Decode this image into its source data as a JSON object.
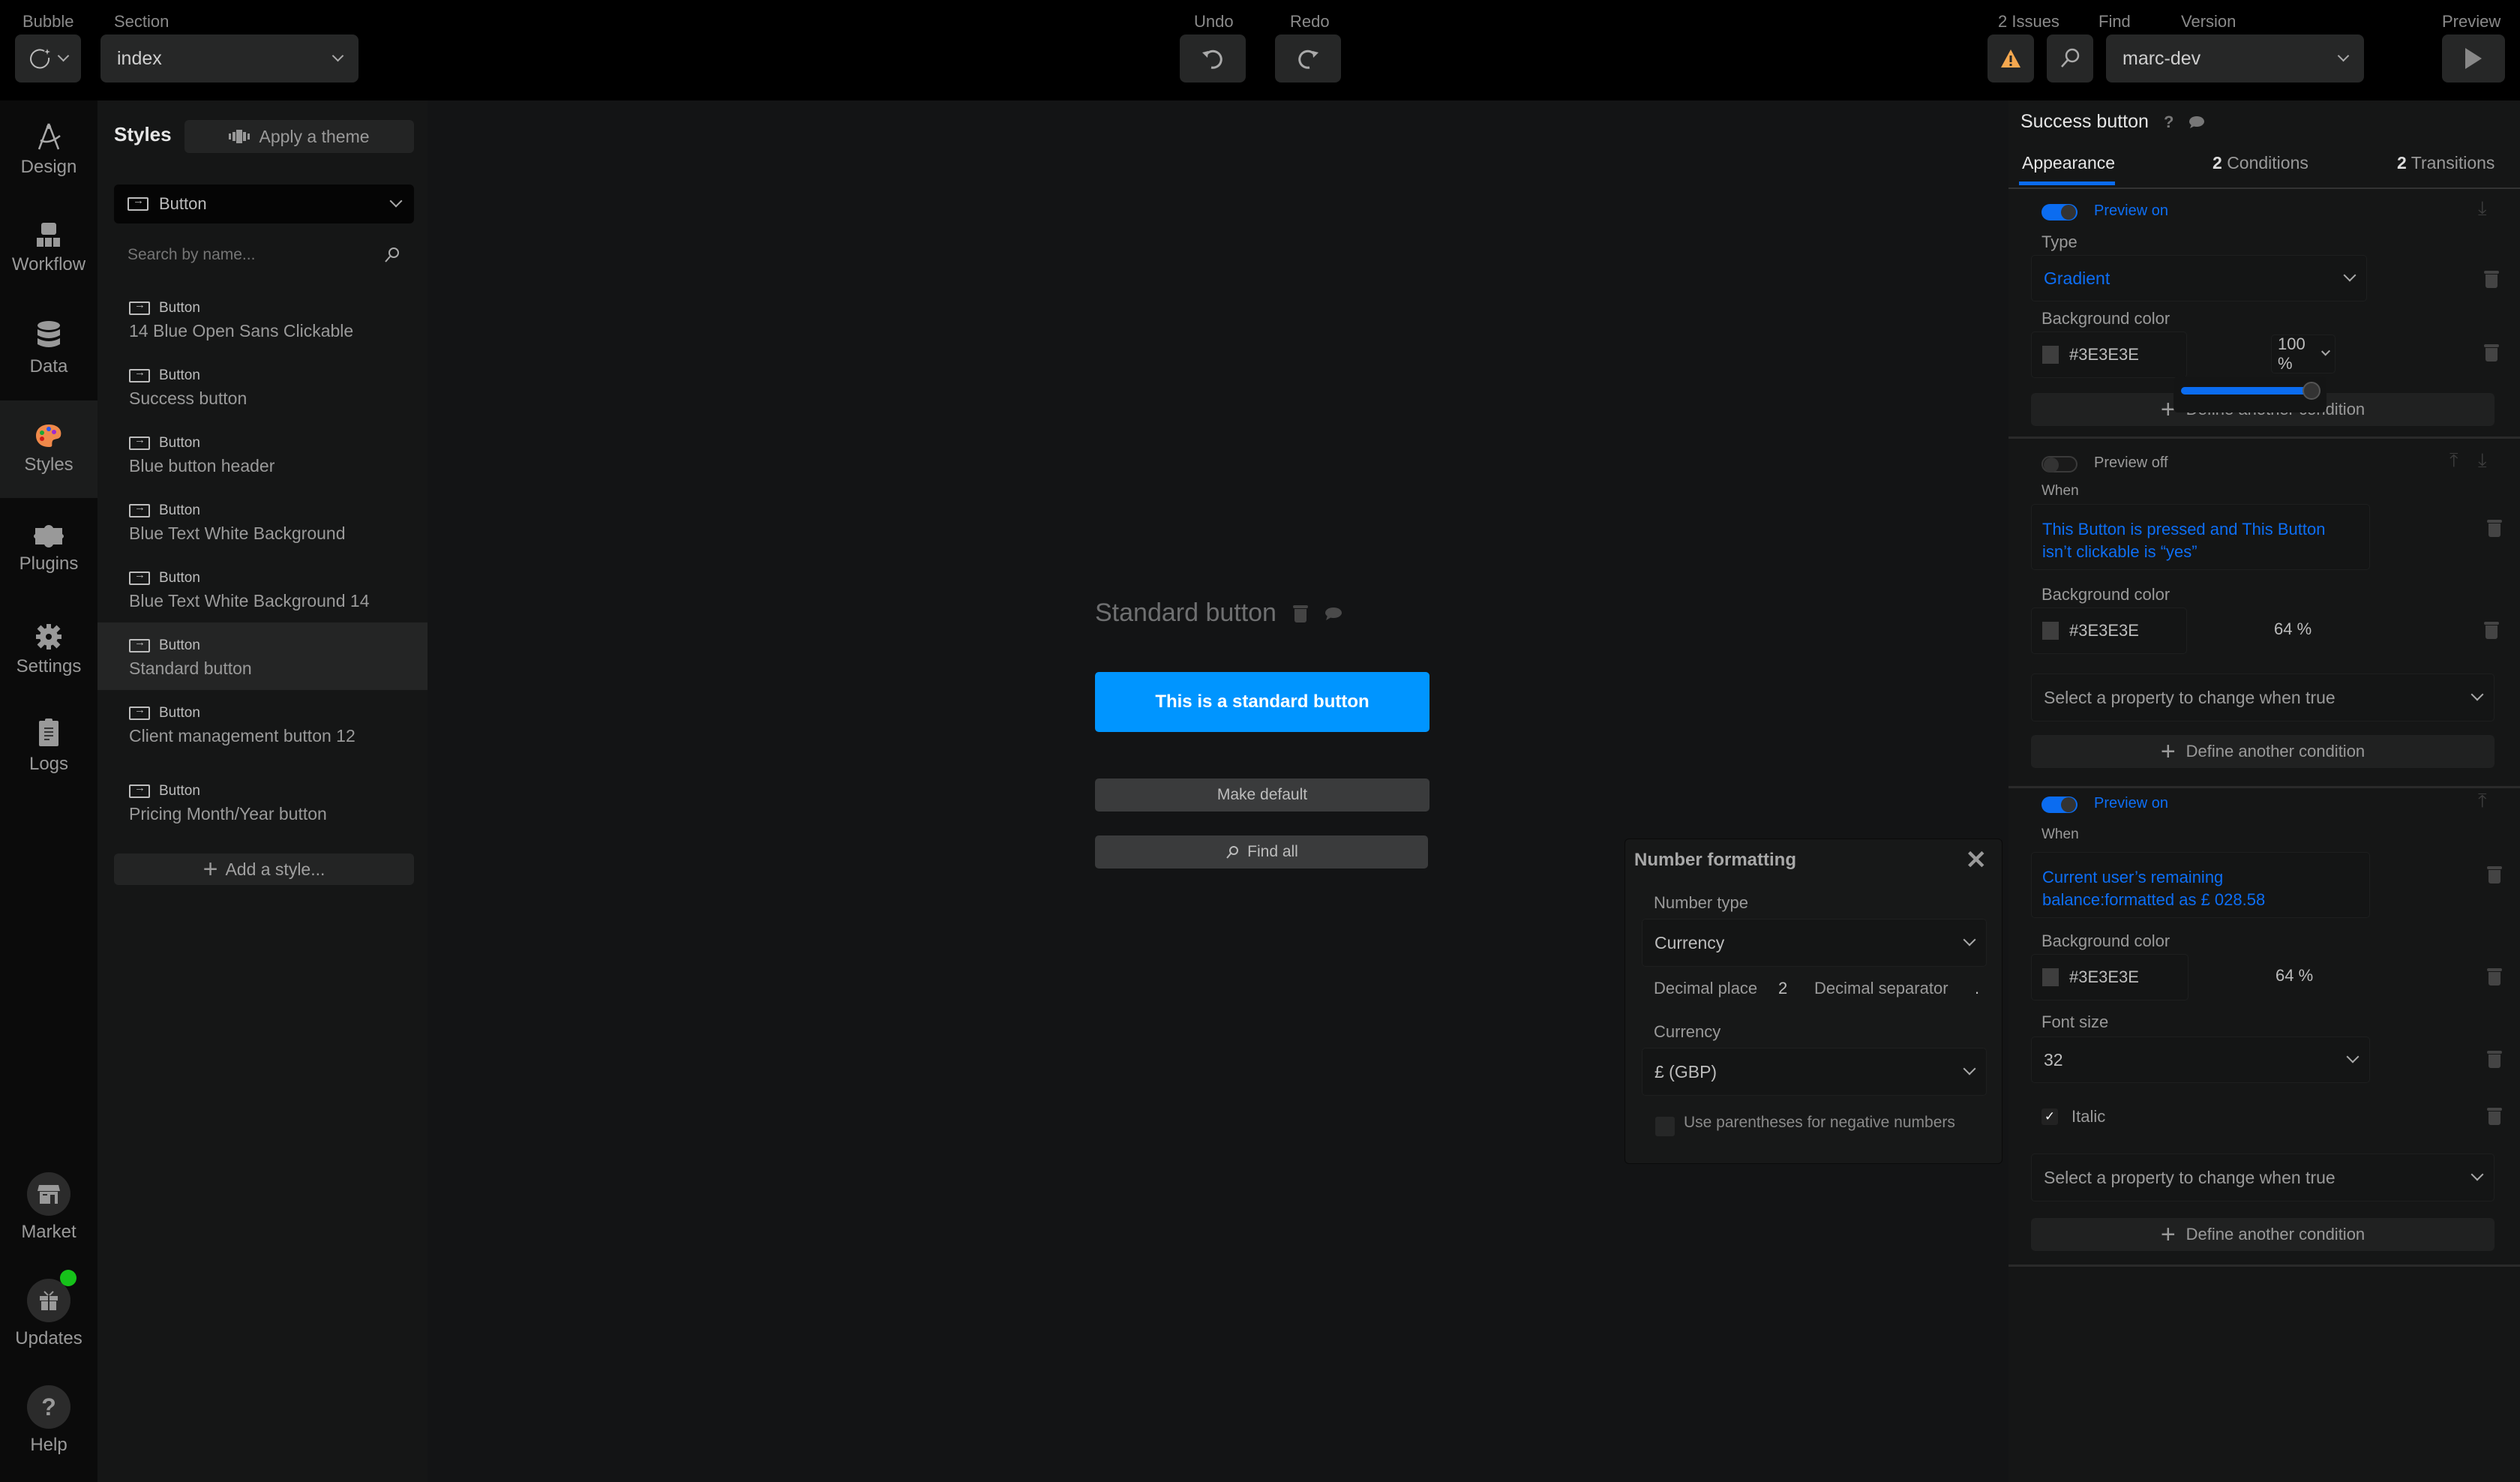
{
  "topbar": {
    "bubble_label": "Bubble",
    "section_label": "Section",
    "section_value": "index",
    "undo_label": "Undo",
    "redo_label": "Redo",
    "issues_label": "2 Issues",
    "find_label": "Find",
    "version_label": "Version",
    "version_value": "marc-dev",
    "preview_label": "Preview",
    "issues_color": "#f6a84f"
  },
  "leftnav": {
    "items": [
      {
        "label": "Design",
        "icon": "compass-icon"
      },
      {
        "label": "Workflow",
        "icon": "workflow-icon"
      },
      {
        "label": "Data",
        "icon": "database-icon"
      },
      {
        "label": "Styles",
        "icon": "palette-icon",
        "active": true
      },
      {
        "label": "Plugins",
        "icon": "puzzle-icon"
      },
      {
        "label": "Settings",
        "icon": "gear-icon"
      },
      {
        "label": "Logs",
        "icon": "clipboard-icon"
      }
    ],
    "bottom": [
      {
        "label": "Market",
        "icon": "store-icon"
      },
      {
        "label": "Updates",
        "icon": "gift-icon",
        "badge_color": "#16c21a"
      },
      {
        "label": "Help",
        "icon": "question-icon"
      }
    ]
  },
  "styles_panel": {
    "title": "Styles",
    "apply_theme": "Apply a theme",
    "type_filter": "Button",
    "search_placeholder": "Search by name...",
    "items": [
      {
        "type": "Button",
        "name": "14 Blue Open Sans Clickable"
      },
      {
        "type": "Button",
        "name": "Success button"
      },
      {
        "type": "Button",
        "name": "Blue button header"
      },
      {
        "type": "Button",
        "name": "Blue Text White Background"
      },
      {
        "type": "Button",
        "name": "Blue Text White Background 14"
      },
      {
        "type": "Button",
        "name": "Standard button",
        "selected": true
      },
      {
        "type": "Button",
        "name": "Client management button 12"
      },
      {
        "type": "Button",
        "name": "Pricing Month/Year button"
      }
    ],
    "add_style": "Add a style..."
  },
  "canvas": {
    "style_title": "Standard button",
    "preview_button": "This is a standard button",
    "preview_color": "#0095ff",
    "make_default": "Make default",
    "find_all": "Find all"
  },
  "number_formatting": {
    "title": "Number formatting",
    "number_type_label": "Number type",
    "number_type_value": "Currency",
    "decimal_place_label": "Decimal place",
    "decimal_place_value": "2",
    "decimal_separator_label": "Decimal separator",
    "decimal_separator_value": ".",
    "currency_label": "Currency",
    "currency_value": "£ (GBP)",
    "parentheses_label": "Use parentheses for negative numbers",
    "parentheses_checked": false
  },
  "properties": {
    "title": "Success button",
    "tabs": [
      {
        "count": "",
        "label": "Appearance",
        "active": true
      },
      {
        "count": "2",
        "label": "Conditions"
      },
      {
        "count": "2",
        "label": "Transitions"
      }
    ],
    "appearance": {
      "preview": "Preview on",
      "type_label": "Type",
      "type_value": "Gradient",
      "bg_label": "Background color",
      "bg_value": "#3E3E3E",
      "opacity": "100 %",
      "opacity_slider_percent": 100,
      "define_condition": "Define another condition"
    },
    "condition1": {
      "preview": "Preview off",
      "when_label": "When",
      "expression": "This Button is pressed and This Button isn’t clickable is “yes”",
      "bg_label": "Background color",
      "bg_value": "#3E3E3E",
      "opacity": "64 %",
      "select_property": "Select a property to change when true",
      "define_condition": "Define another condition"
    },
    "condition2": {
      "preview": "Preview on",
      "when_label": "When",
      "expression": "Current user’s remaining balance:formatted as  £ 028.58",
      "bg_label": "Background color",
      "bg_value": "#3E3E3E",
      "opacity": "64 %",
      "font_size_label": "Font size",
      "font_size_value": "32",
      "italic_label": "Italic",
      "italic_checked": true,
      "select_property": "Select a property to change when true",
      "define_condition": "Define another condition"
    }
  }
}
